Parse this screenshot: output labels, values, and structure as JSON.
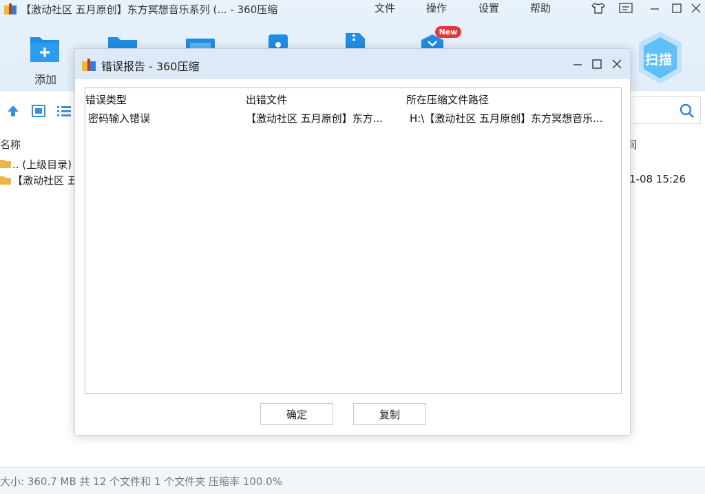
{
  "window": {
    "title": "【激动社区 五月原创】东方冥想音乐系列 (... - 360压缩",
    "menu": [
      "文件",
      "操作",
      "设置",
      "帮助"
    ]
  },
  "toolbar": {
    "add_label": "添加",
    "new_badge": "New",
    "scan_label": "扫描"
  },
  "file_list": {
    "col_name": "名称",
    "col_modified_partial": "间",
    "rows": [
      {
        "name": ".. (上级目录)",
        "modified": ""
      },
      {
        "name": "【激动社区 五",
        "modified": "1-08 15:26"
      }
    ]
  },
  "statusbar": {
    "text": "大小: 360.7 MB 共 12 个文件和 1 个文件夹 压缩率 100.0%"
  },
  "dialog": {
    "title": "错误报告 - 360压缩",
    "columns": [
      "错误类型",
      "出错文件",
      "所在压缩文件路径"
    ],
    "rows": [
      {
        "error_type": "密码输入错误",
        "file": "【激动社区 五月原创】东方...",
        "archive_path": "H:\\【激动社区 五月原创】东方冥想音乐..."
      }
    ],
    "ok_label": "确定",
    "copy_label": "复制"
  },
  "colors": {
    "accent": "#2b8fe0",
    "titlebar_bg": "#e9f2fb",
    "dialog_titlebar_bg": "#dde9f6",
    "badge_red": "#e8353c"
  }
}
